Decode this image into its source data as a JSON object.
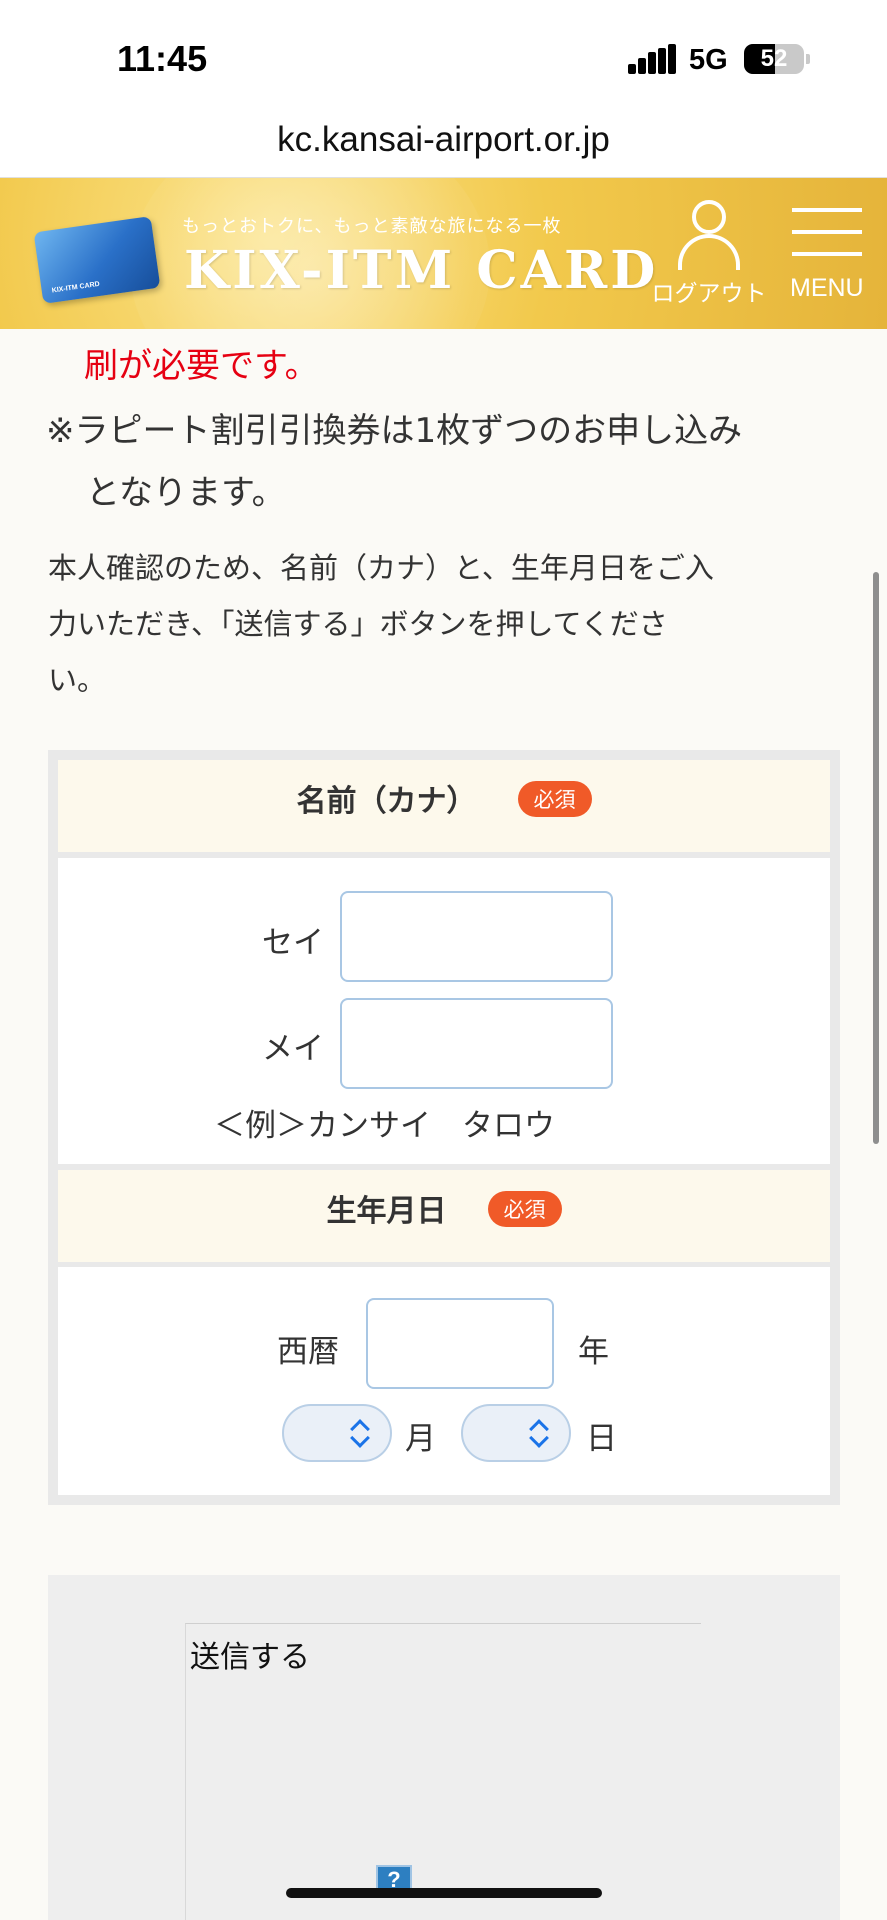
{
  "status_bar": {
    "time": "11:45",
    "network": "5G",
    "battery": "52",
    "battery_level": 0.52
  },
  "browser": {
    "url": "kc.kansai-airport.or.jp"
  },
  "header": {
    "tagline": "もっとおトクに、もっと素敵な旅になる一枚",
    "brand": "KIX-ITM CARD",
    "card_text": "KIX-ITM CARD",
    "logout_label": "ログアウト",
    "menu_label": "MENU"
  },
  "content": {
    "red_line": "刷が必要です。",
    "note_line1": "※ラピート割引引換券は1枚ずつのお申し込み",
    "note_line2": "となります。",
    "intro_line1": "本人確認のため、名前（カナ）と、生年月日をご入",
    "intro_line2": "力いただき、「送信する」ボタンを押してくださ",
    "intro_line3": "い。"
  },
  "form": {
    "name_section": {
      "title": "名前（カナ）",
      "required_badge": "必須",
      "sei_label": "セイ",
      "sei_value": "",
      "mei_label": "メイ",
      "mei_value": "",
      "example": "＜例＞カンサイ　タロウ"
    },
    "birth_section": {
      "title": "生年月日",
      "required_badge": "必須",
      "era_label": "西暦",
      "year_value": "",
      "year_suffix": "年",
      "month_suffix": "月",
      "day_suffix": "日"
    }
  },
  "submit": {
    "label": "送信する",
    "broken_image_glyph": "?"
  },
  "colors": {
    "header_gold": "#f2c94c",
    "red_text": "#e60012",
    "required_badge": "#f05a28",
    "section_head_bg": "#fdf9ec"
  }
}
